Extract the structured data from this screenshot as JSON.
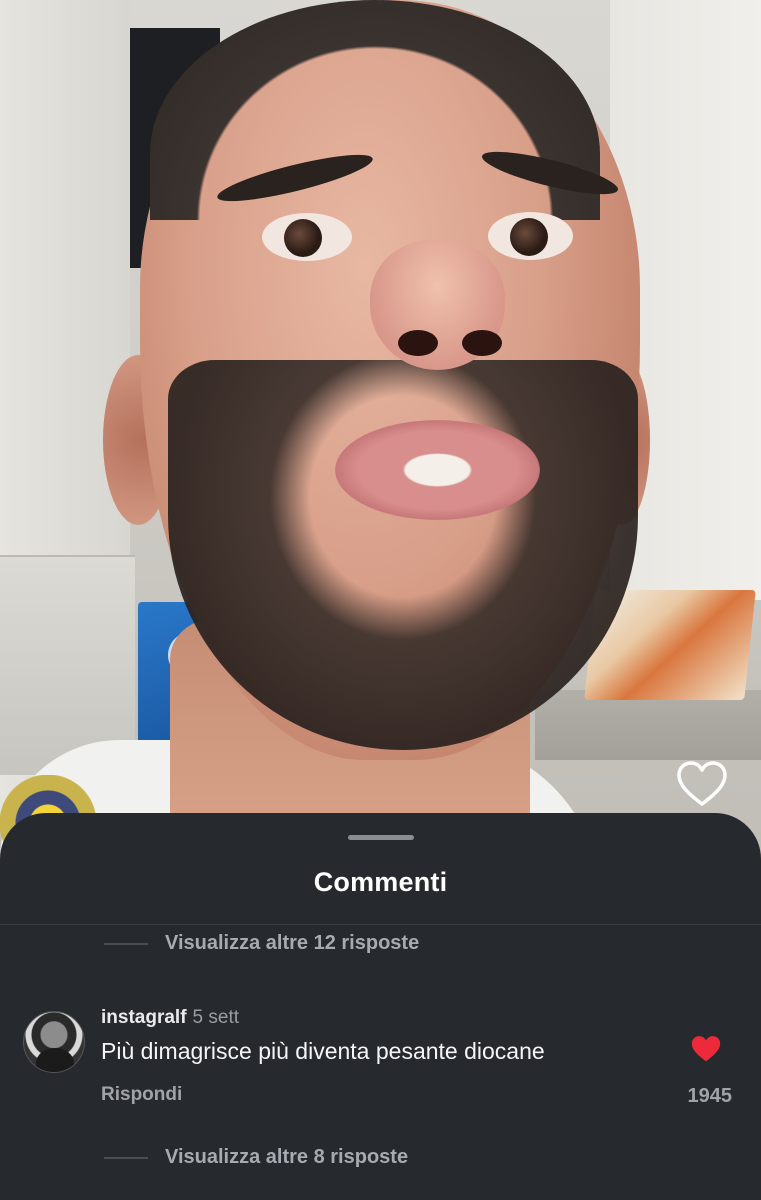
{
  "sheet": {
    "title": "Commenti"
  },
  "thread_top": {
    "view_more_replies": "Visualizza altre 12 risposte"
  },
  "comment": {
    "username": "instagralf",
    "time": "5 sett",
    "text": "Più dimagrisce più diventa pesante diocane",
    "reply_label": "Rispondi",
    "like_count": "1945",
    "liked": true,
    "like_color": "#ed2a3b"
  },
  "thread_bottom": {
    "view_more_replies": "Visualizza altre 8 risposte"
  },
  "video": {
    "like_icon": "heart-outline-icon"
  }
}
